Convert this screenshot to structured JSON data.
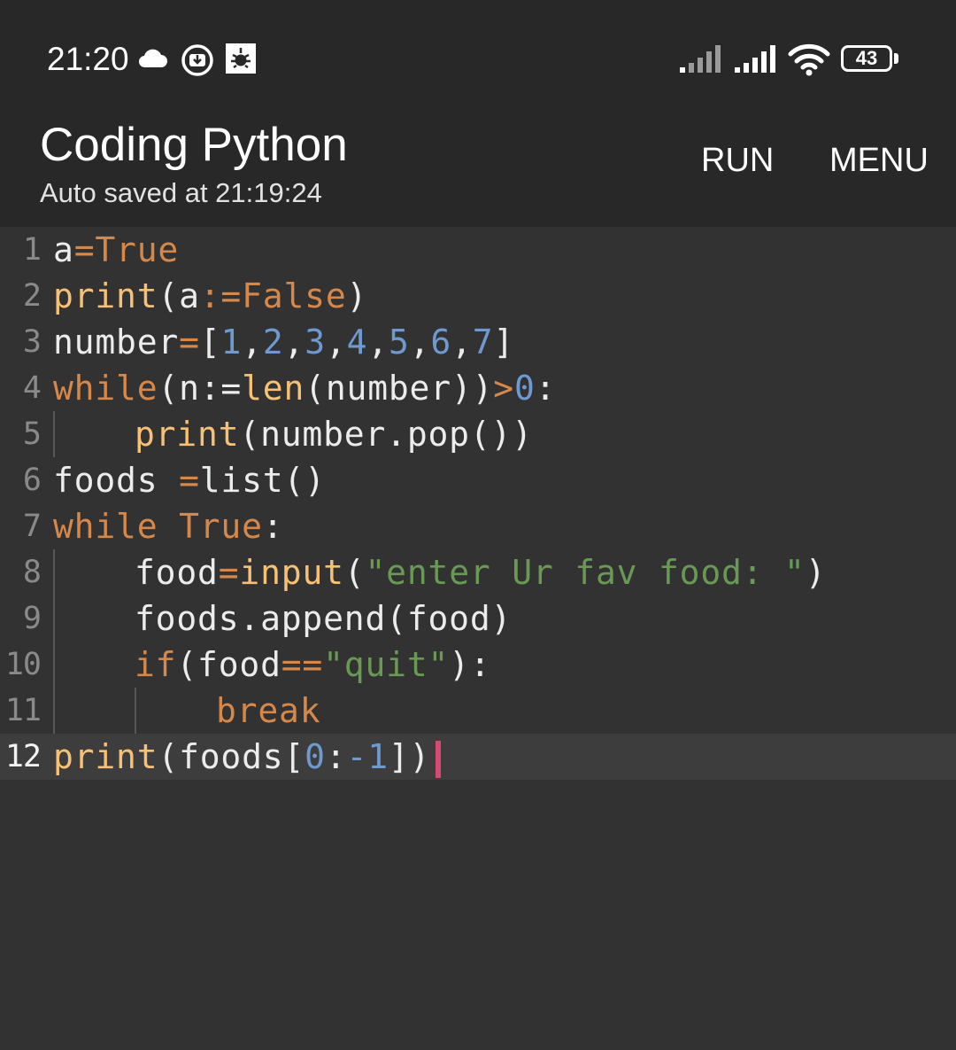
{
  "status_bar": {
    "time": "21:20",
    "icons": [
      "cloud-icon",
      "download-icon",
      "app-notification-icon"
    ],
    "right_icons": [
      "signal-icon",
      "signal-icon",
      "wifi-icon",
      "battery-icon"
    ],
    "battery_level": "43"
  },
  "app_bar": {
    "title": "Coding Python",
    "subtitle": "Auto saved at 21:19:24",
    "run_label": "RUN",
    "menu_label": "MENU"
  },
  "editor": {
    "active_line": 12,
    "lines": [
      {
        "number": "1",
        "indent": 0,
        "tokens": [
          [
            "a",
            "plain"
          ],
          [
            "=",
            "op"
          ],
          [
            "True",
            "constant"
          ]
        ]
      },
      {
        "number": "2",
        "indent": 0,
        "tokens": [
          [
            "print",
            "builtin"
          ],
          [
            "(a",
            "plain"
          ],
          [
            ":=",
            "op"
          ],
          [
            "False",
            "constant"
          ],
          [
            ")",
            "plain"
          ]
        ]
      },
      {
        "number": "3",
        "indent": 0,
        "tokens": [
          [
            "number",
            "plain"
          ],
          [
            "=",
            "op"
          ],
          [
            "[",
            "plain"
          ],
          [
            "1",
            "number"
          ],
          [
            ",",
            "plain"
          ],
          [
            "2",
            "number"
          ],
          [
            ",",
            "plain"
          ],
          [
            "3",
            "number"
          ],
          [
            ",",
            "plain"
          ],
          [
            "4",
            "number"
          ],
          [
            ",",
            "plain"
          ],
          [
            "5",
            "number"
          ],
          [
            ",",
            "plain"
          ],
          [
            "6",
            "number"
          ],
          [
            ",",
            "plain"
          ],
          [
            "7",
            "number"
          ],
          [
            "]",
            "plain"
          ]
        ]
      },
      {
        "number": "4",
        "indent": 0,
        "tokens": [
          [
            "while",
            "keyword"
          ],
          [
            "(n:=",
            "plain"
          ],
          [
            "len",
            "builtin"
          ],
          [
            "(number))",
            "plain"
          ],
          [
            ">",
            "op"
          ],
          [
            "0",
            "number"
          ],
          [
            ":",
            "plain"
          ]
        ]
      },
      {
        "number": "5",
        "indent": 1,
        "tokens": [
          [
            "print",
            "builtin"
          ],
          [
            "(number.pop())",
            "plain"
          ]
        ]
      },
      {
        "number": "6",
        "indent": 0,
        "tokens": [
          [
            "foods ",
            "plain"
          ],
          [
            "=",
            "op"
          ],
          [
            "list()",
            "plain"
          ]
        ]
      },
      {
        "number": "7",
        "indent": 0,
        "tokens": [
          [
            "while",
            "keyword"
          ],
          [
            " ",
            "plain"
          ],
          [
            "True",
            "constant"
          ],
          [
            ":",
            "plain"
          ]
        ]
      },
      {
        "number": "8",
        "indent": 1,
        "tokens": [
          [
            "food",
            "plain"
          ],
          [
            "=",
            "op"
          ],
          [
            "input",
            "builtin"
          ],
          [
            "(",
            "plain"
          ],
          [
            "\"enter Ur fav food: \"",
            "string"
          ],
          [
            ")",
            "plain"
          ]
        ]
      },
      {
        "number": "9",
        "indent": 1,
        "tokens": [
          [
            "foods.append(food)",
            "plain"
          ]
        ]
      },
      {
        "number": "10",
        "indent": 1,
        "tokens": [
          [
            "if",
            "keyword"
          ],
          [
            "(food",
            "plain"
          ],
          [
            "==",
            "op"
          ],
          [
            "\"quit\"",
            "string"
          ],
          [
            "):",
            "plain"
          ]
        ]
      },
      {
        "number": "11",
        "indent": 2,
        "tokens": [
          [
            "break",
            "keyword"
          ]
        ]
      },
      {
        "number": "12",
        "indent": 0,
        "tokens": [
          [
            "print",
            "builtin"
          ],
          [
            "(foods[",
            "plain"
          ],
          [
            "0",
            "number"
          ],
          [
            ":",
            "plain"
          ],
          [
            "-1",
            "number"
          ],
          [
            "])",
            "plain"
          ]
        ]
      }
    ]
  }
}
